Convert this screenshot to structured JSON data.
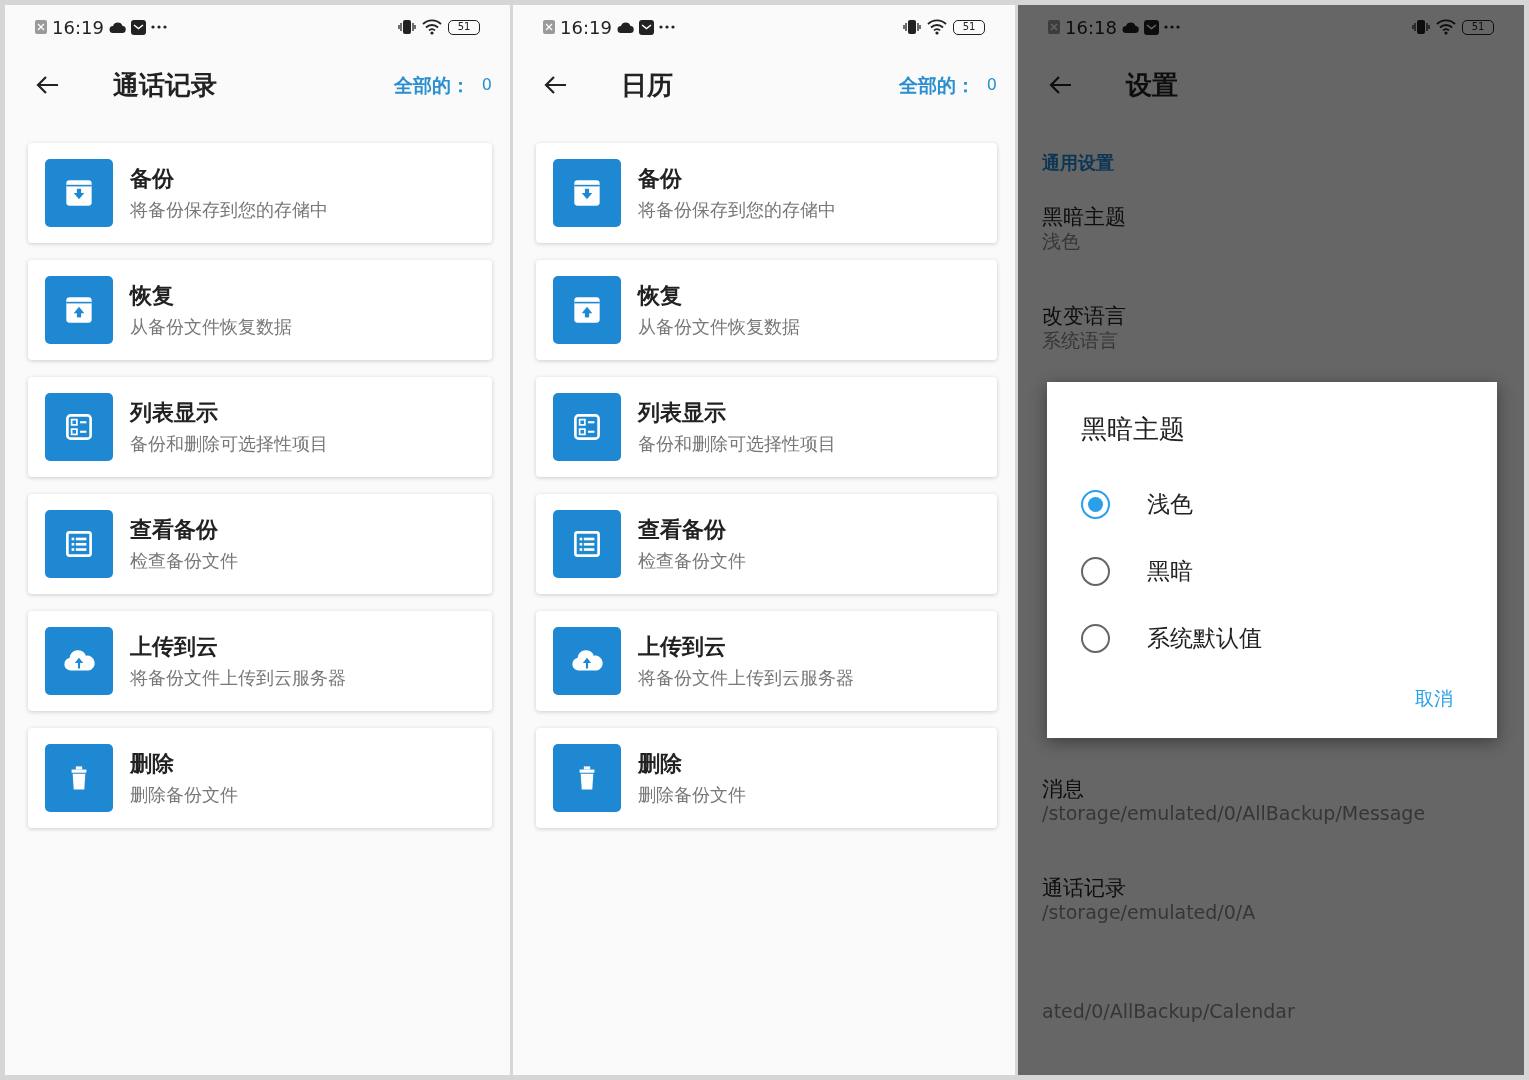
{
  "panels": [
    {
      "kind": "list",
      "status_bar": {
        "time": "16:19",
        "battery": "51"
      },
      "title": "通话记录",
      "total_label": "全部的：",
      "total_count": "0",
      "actions": [
        {
          "kind": "backup",
          "title": "备份",
          "subtitle": "将备份保存到您的存储中"
        },
        {
          "kind": "restore",
          "title": "恢复",
          "subtitle": "从备份文件恢复数据"
        },
        {
          "kind": "list",
          "title": "列表显示",
          "subtitle": "备份和删除可选择性项目"
        },
        {
          "kind": "view",
          "title": "查看备份",
          "subtitle": "检查备份文件"
        },
        {
          "kind": "upload",
          "title": "上传到云",
          "subtitle": "将备份文件上传到云服务器"
        },
        {
          "kind": "delete",
          "title": "删除",
          "subtitle": "删除备份文件"
        }
      ]
    },
    {
      "kind": "list",
      "status_bar": {
        "time": "16:19",
        "battery": "51"
      },
      "title": "日历",
      "total_label": "全部的：",
      "total_count": "0",
      "actions": [
        {
          "kind": "backup",
          "title": "备份",
          "subtitle": "将备份保存到您的存储中"
        },
        {
          "kind": "restore",
          "title": "恢复",
          "subtitle": "从备份文件恢复数据"
        },
        {
          "kind": "list",
          "title": "列表显示",
          "subtitle": "备份和删除可选择性项目"
        },
        {
          "kind": "view",
          "title": "查看备份",
          "subtitle": "检查备份文件"
        },
        {
          "kind": "upload",
          "title": "上传到云",
          "subtitle": "将备份文件上传到云服务器"
        },
        {
          "kind": "delete",
          "title": "删除",
          "subtitle": "删除备份文件"
        }
      ]
    },
    {
      "kind": "settings",
      "status_bar": {
        "time": "16:18",
        "battery": "51"
      },
      "title": "设置",
      "groups": [
        {
          "header": "通用设置",
          "items": [
            {
              "title": "黑暗主题",
              "value": "浅色"
            },
            {
              "title": "改变语言",
              "value": "系统语言"
            }
          ]
        },
        {
          "items": [
            {
              "title": "消息",
              "value": "/storage/emulated/0/AllBackup/Message"
            },
            {
              "title": "通话记录",
              "value": "/storage/emulated/0/A"
            },
            {
              "value": "ated/0/AllBackup/Calendar"
            }
          ]
        }
      ],
      "dialog": {
        "title": "黑暗主题",
        "options": [
          {
            "label": "浅色",
            "selected": true
          },
          {
            "label": "黑暗",
            "selected": false
          },
          {
            "label": "系统默认值",
            "selected": false
          }
        ],
        "cancel": "取消"
      }
    }
  ]
}
